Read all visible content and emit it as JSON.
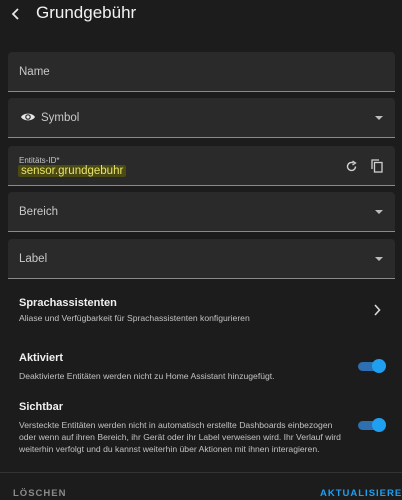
{
  "header": {
    "title": "Grundgebühr"
  },
  "form": {
    "name_label": "Name",
    "symbol_label": "Symbol",
    "entity_id_label": "Entitäts-ID*",
    "entity_id_value": "sensor.grundgebuhr",
    "area_label": "Bereich",
    "label_label": "Label"
  },
  "voice": {
    "title": "Sprachassistenten",
    "description": "Aliase und Verfügbarkeit für Sprachassistenten konfigurieren"
  },
  "enabled": {
    "title": "Aktiviert",
    "description": "Deaktivierte Entitäten werden nicht zu Home Assistant hinzugefügt.",
    "on": true
  },
  "visible": {
    "title": "Sichtbar",
    "description_line1": "Versteckte Entitäten werden nicht in automatisch erstellte Dashboards einbezogen",
    "description_line2": "oder wenn auf ihren Bereich, ihr Gerät oder ihr Label verweisen wird. Ihr Verlauf wird",
    "description_line3": "weiterhin verfolgt und du kannst weiterhin über Aktionen mit ihnen interagieren.",
    "on": true
  },
  "footer": {
    "delete_label": "LÖSCHEN",
    "update_label": "AKTUALISIEREN"
  },
  "colors": {
    "accent": "#1f9ff0",
    "entity_highlight_bg": "#4a4a12",
    "entity_highlight_text": "#e8e36a"
  },
  "icons": [
    "back-arrow-icon",
    "eye-icon",
    "refresh-icon",
    "copy-icon",
    "chevron-right-icon",
    "dropdown-caret-icon"
  ]
}
